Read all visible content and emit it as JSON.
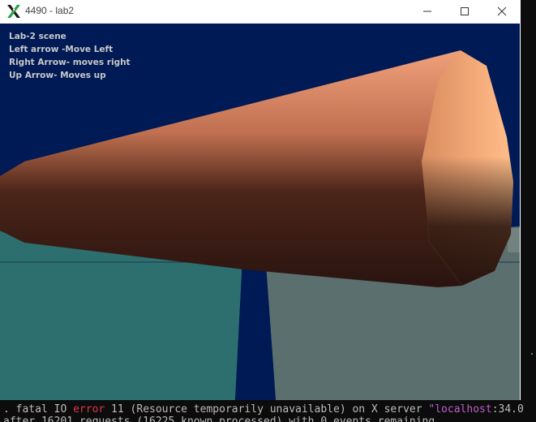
{
  "window": {
    "title": "4490 - lab2",
    "buttons": {
      "minimize": "minimize",
      "maximize": "maximize",
      "close": "close"
    }
  },
  "hud": {
    "lines": [
      "Lab-2 scene",
      "Left arrow -Move Left",
      "Right Arrow- moves right",
      "Up Arrow- Moves up"
    ]
  },
  "terminal": {
    "line1_prefix": ".  fatal IO ",
    "line1_error": "error",
    "line1_mid": " 11 (Resource temporarily unavailable) on X server ",
    "line1_host": "\"localhost",
    "line1_suffix": ":34.0",
    "line2": "     after 16201 requests (16225 known processed) with 0 events remaining.",
    "side_chars": ".h"
  },
  "colors": {
    "background": "#001a55",
    "floor_left": "#2d6f6e",
    "floor_right": "#5a6f6e",
    "cone_dark": "#2a1410",
    "cone_light": "#f2a878"
  }
}
